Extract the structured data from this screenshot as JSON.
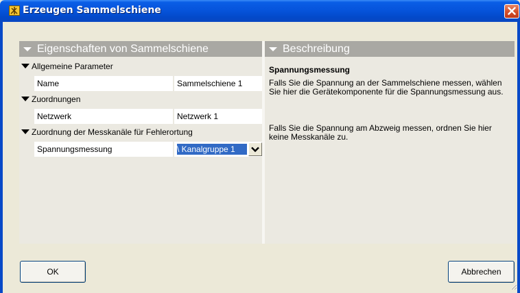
{
  "window": {
    "title": "Erzeugen Sammelschiene",
    "app_icon": "tool-icon",
    "close_icon": "close-icon",
    "title_color": "#0a5ee6",
    "close_color": "#d6512c"
  },
  "properties": {
    "header": "Eigenschaften von Sammelschiene",
    "categories": [
      {
        "label": "Allgemeine Parameter",
        "rows": [
          {
            "name": "Name",
            "value": "Sammelschiene 1"
          }
        ]
      },
      {
        "label": "Zuordnungen",
        "rows": [
          {
            "name": "Netzwerk",
            "value": "Netzwerk 1"
          }
        ]
      },
      {
        "label": "Zuordnung der Messkanäle für Fehlerortung",
        "rows": [
          {
            "name": "Spannungsmessung",
            "value": "\\ Kanalgruppe 1"
          }
        ]
      }
    ],
    "selection_color": "#316ac5"
  },
  "description": {
    "header": "Beschreibung",
    "title": "Spannungsmessung",
    "paragraph1": "Falls Sie die Spannung an der Sammelschiene messen, wählen Sie hier die Gerätekomponente für die Spannungsmessung aus.",
    "paragraph2": "Falls Sie die Spannung am Abzweig messen, ordnen Sie hier keine Messkanäle zu."
  },
  "buttons": {
    "ok": "OK",
    "cancel": "Abbrechen"
  }
}
